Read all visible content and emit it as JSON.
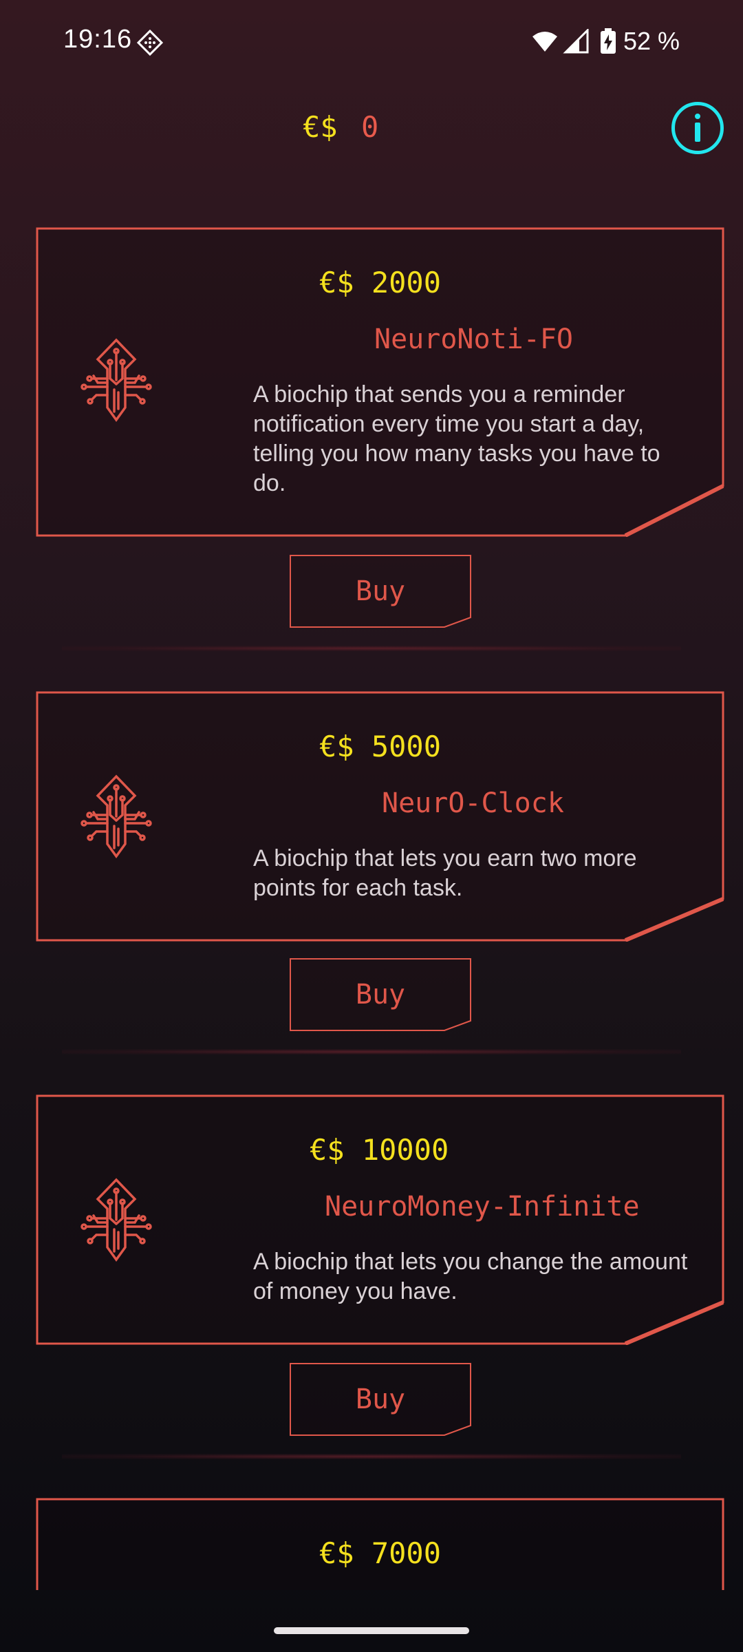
{
  "status_bar": {
    "time": "19:16",
    "battery": "52 %"
  },
  "header": {
    "currency_symbol": "€$",
    "balance": "0"
  },
  "shop": {
    "items": [
      {
        "price": "€$ 2000",
        "name": "NeuroNoti-FO",
        "description": "A biochip that sends you a reminder notification every time you start a day, telling you how many tasks you have to do.",
        "buy_label": "Buy"
      },
      {
        "price": "€$ 5000",
        "name": "NeurO-Clock",
        "description": "A biochip that lets you earn two more points for each task.",
        "buy_label": "Buy"
      },
      {
        "price": "€$ 10000",
        "name": "NeuroMoney-Infinite",
        "description": "A biochip that lets you change the amount of money you have.",
        "buy_label": "Buy"
      },
      {
        "price": "€$ 7000"
      }
    ]
  },
  "colors": {
    "accent_yellow": "#f4e01e",
    "accent_red": "#e0574a",
    "accent_cyan": "#22e6ee"
  },
  "icons": {
    "item_icon": "biochip-circuit-icon",
    "info": "info-icon"
  }
}
